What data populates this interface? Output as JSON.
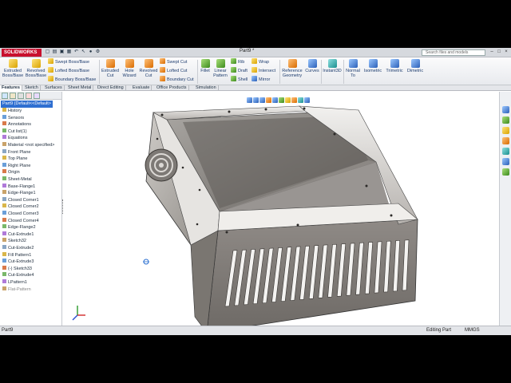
{
  "titlebar": {
    "logo": "SOLIDWORKS",
    "document": "Part9 *",
    "search_placeholder": "Search files and models",
    "window_buttons": [
      "–",
      "□",
      "×"
    ]
  },
  "ribbon": {
    "features": {
      "extruded_boss": "Extruded\nBoss/Base",
      "revolved_boss": "Revolved\nBoss/Base",
      "swept_boss": "Swept Boss/Base",
      "lofted_boss": "Lofted Boss/Base",
      "boundary_boss": "Boundary Boss/Base",
      "extruded_cut": "Extruded\nCut",
      "hole_wizard": "Hole\nWizard",
      "revolved_cut": "Revolved\nCut",
      "swept_cut": "Swept Cut",
      "lofted_cut": "Lofted Cut",
      "boundary_cut": "Boundary Cut",
      "fillet": "Fillet",
      "linear_pattern": "Linear\nPattern",
      "rib": "Rib",
      "draft": "Draft",
      "shell": "Shell",
      "wrap": "Wrap",
      "intersect": "Intersect",
      "mirror": "Mirror",
      "reference_geometry": "Reference\nGeometry",
      "curves": "Curves",
      "instant3d": "Instant3D",
      "normal_to": "Normal\nTo",
      "isometric": "Isometric",
      "trimetric": "Trimetric",
      "dimetric": "Dimetric"
    }
  },
  "tabs": [
    "Features",
    "Sketch",
    "Surfaces",
    "Sheet Metal",
    "Direct Editing",
    "Evaluate",
    "Office Products",
    "Simulation"
  ],
  "tree": {
    "root": "Part9  (Default<<Default>",
    "items": [
      {
        "label": "History",
        "icon": "folder-icon"
      },
      {
        "label": "Sensors",
        "icon": "sensor-icon"
      },
      {
        "label": "Annotations",
        "icon": "annotation-icon"
      },
      {
        "label": "Cut list(1)",
        "icon": "cutlist-icon"
      },
      {
        "label": "Equations",
        "icon": "equation-icon"
      },
      {
        "label": "Material <not specified>",
        "icon": "material-icon"
      },
      {
        "label": "Front Plane",
        "icon": "plane-icon"
      },
      {
        "label": "Top Plane",
        "icon": "plane-icon"
      },
      {
        "label": "Right Plane",
        "icon": "plane-icon"
      },
      {
        "label": "Origin",
        "icon": "origin-icon"
      },
      {
        "label": "Sheet-Metal",
        "icon": "sheetmetal-icon"
      },
      {
        "label": "Base-Flange1",
        "icon": "flange-icon"
      },
      {
        "label": "Edge-Flange1",
        "icon": "flange-icon"
      },
      {
        "label": "Closed Corner1",
        "icon": "corner-icon"
      },
      {
        "label": "Closed Corner2",
        "icon": "corner-icon"
      },
      {
        "label": "Closed Corner3",
        "icon": "corner-icon"
      },
      {
        "label": "Closed Corner4",
        "icon": "corner-icon"
      },
      {
        "label": "Edge-Flange2",
        "icon": "flange-icon"
      },
      {
        "label": "Cut-Extrude1",
        "icon": "cut-icon"
      },
      {
        "label": "Sketch32",
        "icon": "sketch-icon"
      },
      {
        "label": "Cut-Extrude2",
        "icon": "cut-icon"
      },
      {
        "label": "Fill Pattern1",
        "icon": "pattern-icon"
      },
      {
        "label": "Cut-Extrude3",
        "icon": "cut-icon"
      },
      {
        "label": "(-) Sketch33",
        "icon": "sketch-icon"
      },
      {
        "label": "Cut-Extrude4",
        "icon": "cut-icon"
      },
      {
        "label": "LPattern1",
        "icon": "pattern-icon"
      },
      {
        "label": "Flat-Pattern",
        "icon": "flat-icon"
      }
    ]
  },
  "status": {
    "left": "Part9",
    "mode": "Editing Part",
    "units": "MMGS"
  },
  "colors": {
    "accent": "#2f6fd1",
    "brand": "#c8102e",
    "model_face": "#8a8580"
  }
}
